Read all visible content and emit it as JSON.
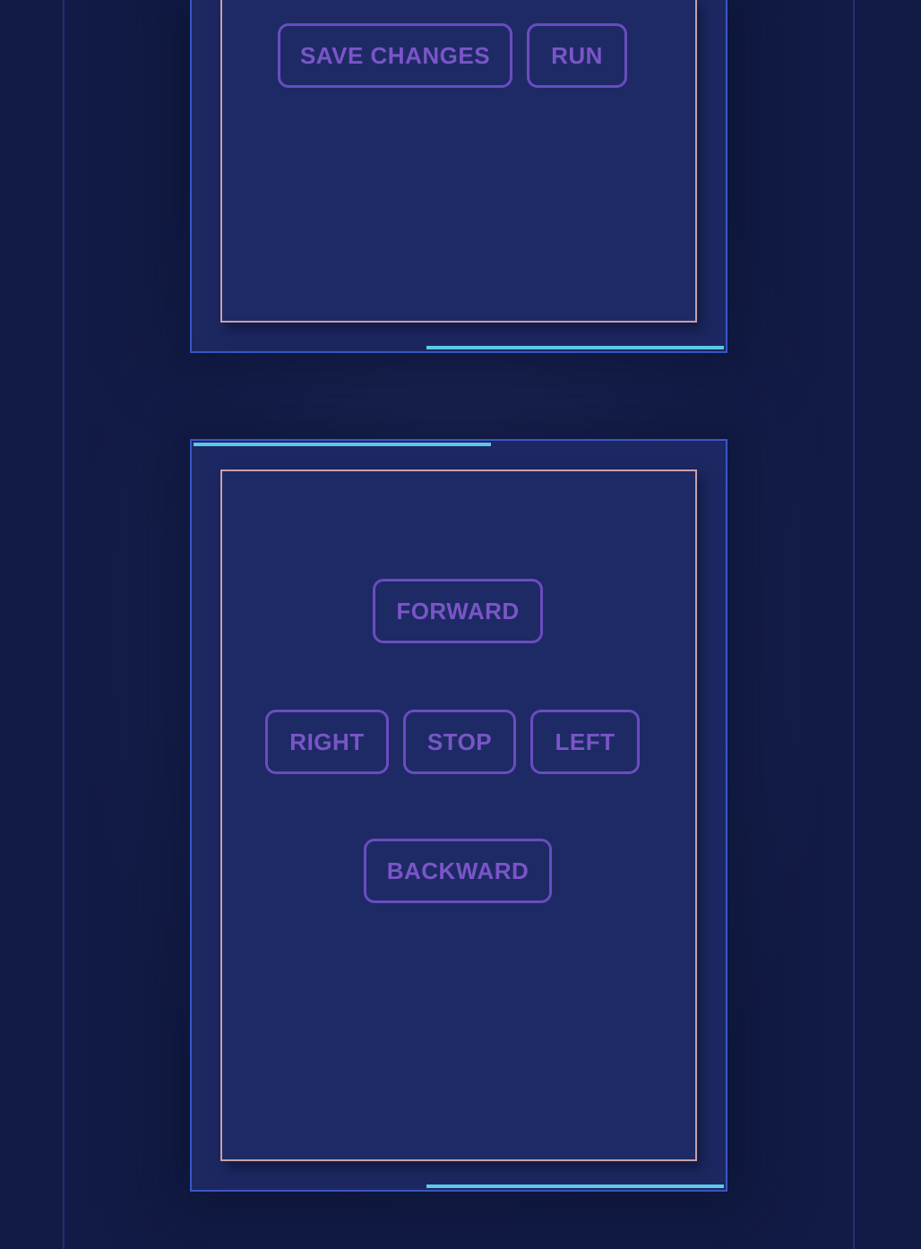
{
  "editor": {
    "save_label": "SAVE CHANGES",
    "run_label": "RUN"
  },
  "controls": {
    "forward_label": "FORWARD",
    "right_label": "RIGHT",
    "stop_label": "STOP",
    "left_label": "LEFT",
    "backward_label": "BACKWARD"
  },
  "colors": {
    "background": "#121b45",
    "panel": "#1d2862",
    "panel_border": "#3a56c5",
    "inner_border": "#c8a0a8",
    "accent": "#5ec8e8",
    "button": "#6a4cc0"
  }
}
